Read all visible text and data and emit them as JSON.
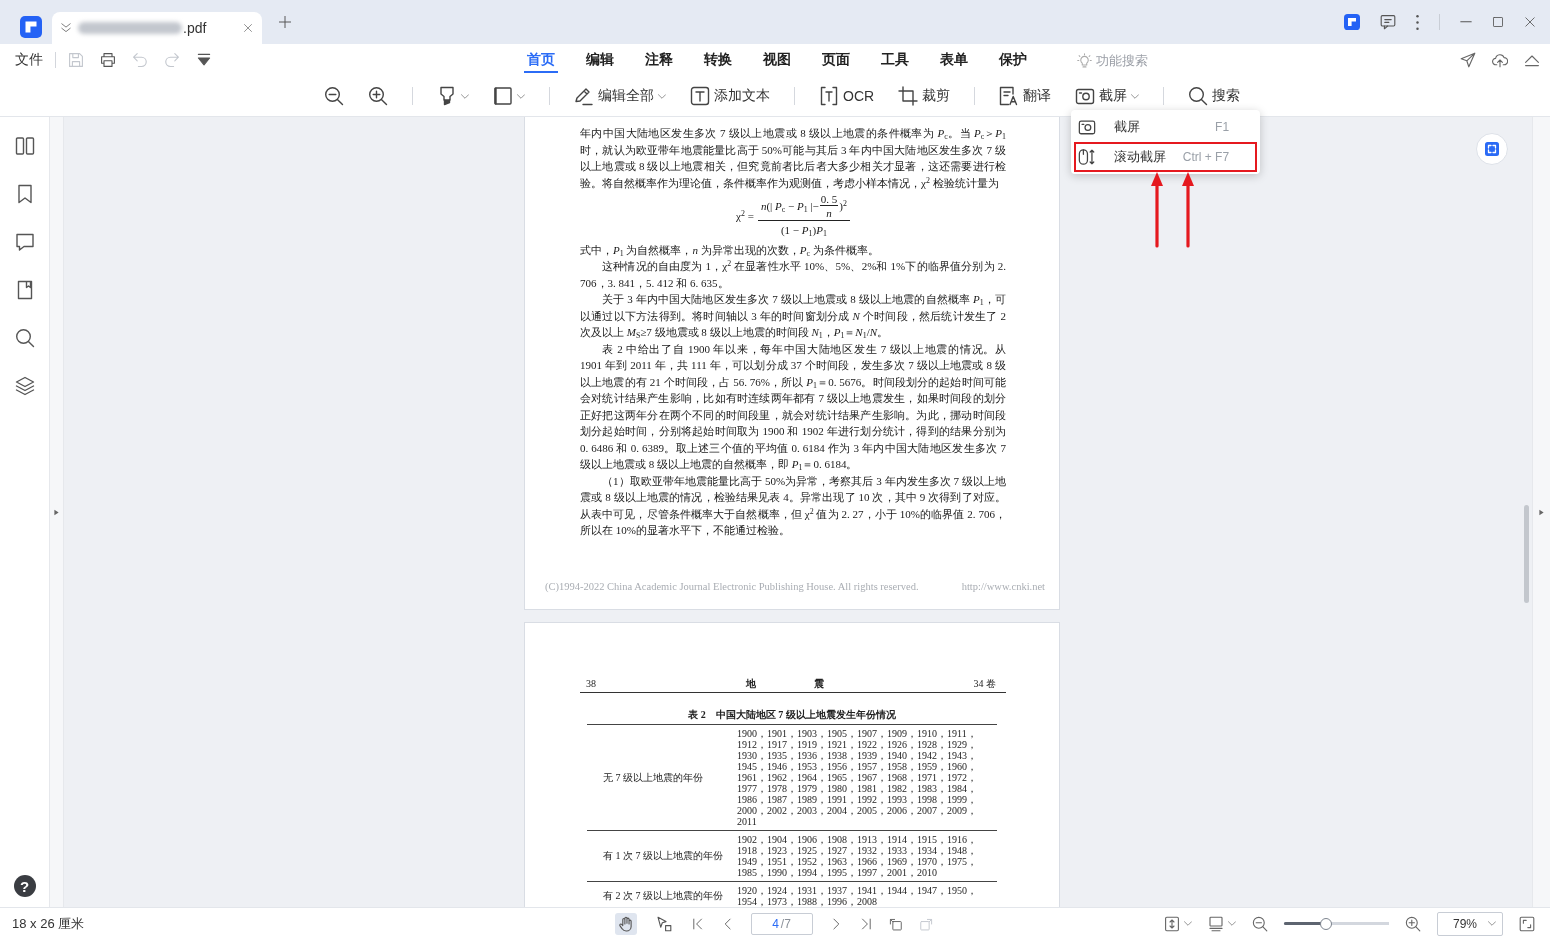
{
  "title_bar": {
    "file_tab": {
      "name": ".pdf",
      "blurred": true,
      "selected": true
    }
  },
  "quick_bar": {
    "file_menu": "文件",
    "actions": [
      {
        "kind": "save",
        "disabled": true
      },
      {
        "kind": "print",
        "disabled": false
      },
      {
        "kind": "undo",
        "disabled": true
      },
      {
        "kind": "redo",
        "disabled": true
      },
      {
        "kind": "customize",
        "disabled": false
      }
    ]
  },
  "menu_tabs": [
    {
      "label": "首页",
      "selected": true
    },
    {
      "label": "编辑",
      "selected": false
    },
    {
      "label": "注释",
      "selected": false
    },
    {
      "label": "转换",
      "selected": false
    },
    {
      "label": "视图",
      "selected": false
    },
    {
      "label": "页面",
      "selected": false
    },
    {
      "label": "工具",
      "selected": false
    },
    {
      "label": "表单",
      "selected": false
    },
    {
      "label": "保护",
      "selected": false
    }
  ],
  "feature_search": {
    "placeholder": "功能搜索"
  },
  "toolbar": [
    {
      "kind": "zoom-out"
    },
    {
      "kind": "zoom-in"
    },
    {
      "kind": "separator"
    },
    {
      "kind": "highlight",
      "dropdown": true
    },
    {
      "kind": "shape",
      "dropdown": true
    },
    {
      "kind": "separator"
    },
    {
      "kind": "edit-all",
      "label": "编辑全部",
      "dropdown": true
    },
    {
      "kind": "add-text",
      "label": "添加文本",
      "dropdown": false
    },
    {
      "kind": "separator"
    },
    {
      "kind": "ocr",
      "label": "OCR",
      "dropdown": false
    },
    {
      "kind": "crop",
      "label": "裁剪",
      "dropdown": false
    },
    {
      "kind": "separator"
    },
    {
      "kind": "translate",
      "label": "翻译",
      "dropdown": false
    },
    {
      "kind": "screenshot",
      "label": "截屏",
      "dropdown": true,
      "expanded": true,
      "menu": [
        {
          "kind": "capture",
          "label": "截屏",
          "shortcut": "F1",
          "highlighted": false
        },
        {
          "kind": "scroll-capture",
          "label": "滚动截屏",
          "shortcut": "Ctrl + F7",
          "highlighted": true
        }
      ]
    },
    {
      "kind": "separator"
    },
    {
      "kind": "search",
      "label": "搜索",
      "dropdown": false
    }
  ],
  "sidebar": [
    {
      "kind": "thumbnails"
    },
    {
      "kind": "bookmarks"
    },
    {
      "kind": "comments"
    },
    {
      "kind": "attachments"
    },
    {
      "kind": "search"
    },
    {
      "kind": "layers"
    }
  ],
  "help": {
    "label": "?"
  },
  "page_1": {
    "blocks": [
      {
        "kind": "paragraph",
        "indent": false,
        "text": "年内中国大陆地区发生多次 7 级以上地震或 8 级以上地震的条件概率为 *P*$_{c}$。当 *P*$_{c}$＞*P*$_{1}$ 时，就认为欧亚带年地震能量比高于 50%可能与其后 3 年内中国大陆地区发生多次 7 级以上地震或 8 级以上地震相关，但究竟前者比后者大多少相关才显著，这还需要进行检验。将自然概率作为理论值，条件概率作为观测值，考虑小样本情况，χ$^{2}$ 检验统计量为"
      },
      {
        "kind": "formula",
        "lhs": "χ$^{2}$ =",
        "numerator_start": "*n*(| *P*$_{c}$ − *P*$_{1}$ |−",
        "inner_numerator": "0. 5",
        "inner_denominator": "*n*",
        "numerator_end": ")$^{2}$",
        "denominator": "(1 − *P*$_{1}$)*P*$_{1}$"
      },
      {
        "kind": "paragraph",
        "indent": false,
        "text": "式中，*P*$_{1}$ 为自然概率，*n* 为异常出现的次数，*P*$_{c}$ 为条件概率。"
      },
      {
        "kind": "paragraph",
        "indent": true,
        "text": "这种情况的自由度为 1，χ$^{2}$ 在显著性水平 10%、5%、2%和 1%下的临界值分别为 2. 706，3. 841，5. 412 和 6. 635。"
      },
      {
        "kind": "paragraph",
        "indent": true,
        "text": "关于 3 年内中国大陆地区发生多次 7 级以上地震或 8 级以上地震的自然概率 *P*$_{1}$，可以通过以下方法得到。将时间轴以 3 年的时间窗划分成 *N* 个时间段，然后统计发生了 2 次及以上 *M*$_{S}$≥7 级地震或 8 级以上地震的时间段 *N*$_{1}$，*P*$_{1}$＝*N*$_{1}$/*N*。"
      },
      {
        "kind": "paragraph",
        "indent": true,
        "text": "表 2 中给出了自 1900 年以来，每年中国大陆地区发生 7 级以上地震的情况。从 1901 年到 2011 年，共 111 年，可以划分成 37 个时间段，发生多次 7 级以上地震或 8 级以上地震的有 21 个时间段，占 56. 76%，所以 *P*$_{1}$＝0. 5676。时间段划分的起始时间可能会对统计结果产生影响，比如有时连续两年都有 7 级以上地震发生，如果时间段的划分正好把这两年分在两个不同的时间段里，就会对统计结果产生影响。为此，挪动时间段划分起始时间，分别将起始时间取为 1900 和 1902 年进行划分统计，得到的结果分别为 0. 6486 和 0. 6389。取上述三个值的平均值 0. 6184 作为 3 年内中国大陆地区发生多次 7 级以上地震或 8 级以上地震的自然概率，即 *P*$_{1}$＝0. 6184。"
      },
      {
        "kind": "paragraph",
        "indent": true,
        "text": "（1）取欧亚带年地震能量比高于 50%为异常，考察其后 3 年内发生多次 7 级以上地震或 8 级以上地震的情况，检验结果见表 4。异常出现了 10 次，其中 9 次得到了对应。从表中可见，尽管条件概率大于自然概率，但 χ$^{2}$ 值为 2. 27，小于 10%的临界值 2. 706，所以在 10%的显著水平下，不能通过检验。"
      }
    ],
    "footer": {
      "copyright": "(C)1994-2022 China Academic Journal Electronic Publishing House. All rights reserved.",
      "url": "http://www.cnki.net"
    }
  },
  "page_2": {
    "header": {
      "page_number": "38",
      "journal": "地 震",
      "volume": "34 卷"
    },
    "table": {
      "caption": "表 2　中国大陆地区 7 级以上地震发生年份情况",
      "rows": [
        {
          "label": "无 7 级以上地震的年份",
          "years": "1900，1901，1903，1905，1907，1909，1910，1911，1912，1917，1919，1921，1922，1926，1928，1929，1930，1935，1936，1938，1939，1940，1942，1943，1945，1946，1953，1956，1957，1958，1959，1960，1961，1962，1964，1965，1967，1968，1971，1972，1977，1978，1979，1980，1981，1982，1983，1984，1986，1987，1989，1991，1992，1993，1998，1999，2000，2002，2003，2004，2005，2006，2007，2009，2011"
        },
        {
          "label": "有 1 次 7 级以上地震的年份",
          "years": "1902，1904，1906，1908，1913，1914，1915，1916，1918，1923，1925，1927，1932，1933，1934，1948，1949，1951，1952，1963，1966，1969，1970，1975，1985，1990，1994，1995，1997，2001，2010"
        },
        {
          "label": "有 2 次 7 级以上地震的年份",
          "years": "1920，1924，1931，1937，1941，1944，1947，1950，1954，1973，1988，1996，2008"
        }
      ]
    }
  },
  "status_bar": {
    "page_size": "18 x 26 厘米",
    "tools": [
      {
        "kind": "hand",
        "selected": true
      },
      {
        "kind": "select",
        "selected": false
      }
    ],
    "navigation": [
      {
        "kind": "first",
        "disabled": false
      },
      {
        "kind": "previous",
        "disabled": false
      },
      {
        "kind": "page-field",
        "value": "4",
        "total": "/7"
      },
      {
        "kind": "next",
        "disabled": false
      },
      {
        "kind": "last",
        "disabled": false
      },
      {
        "kind": "rotate-left",
        "disabled": false
      },
      {
        "kind": "rotate-right",
        "disabled": true
      }
    ],
    "zoom": {
      "level": 0.4,
      "value": "79%"
    }
  }
}
